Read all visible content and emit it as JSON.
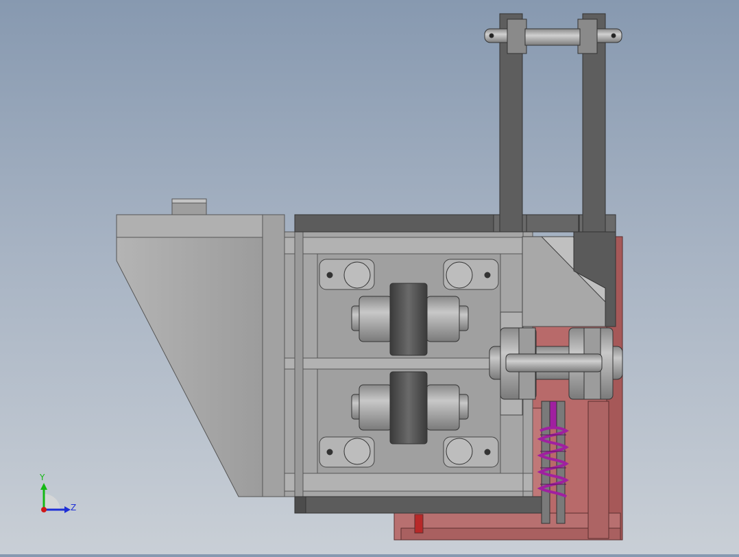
{
  "viewport": {
    "background_top": "#8799b0",
    "background_bottom": "#c9cfd6"
  },
  "triad": {
    "y_label": "Y",
    "z_label": "Z",
    "y_color": "#14b814",
    "z_color": "#1e2fd6",
    "x_color": "#d01818"
  },
  "colors": {
    "body_gray": "#a4a4a4",
    "dark_gray": "#5c5c5c",
    "frame_red": "#b86a6a",
    "spring": "#a020a0"
  }
}
